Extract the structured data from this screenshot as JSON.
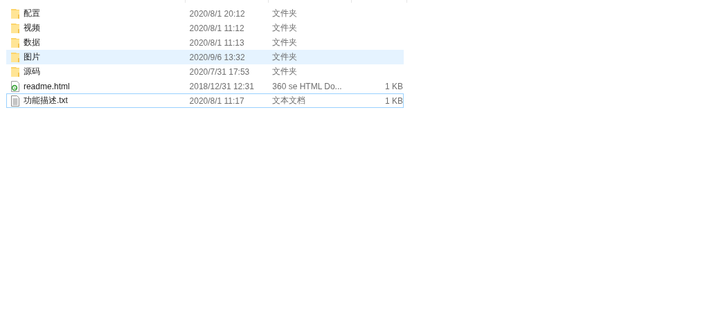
{
  "files": [
    {
      "kind": "folder",
      "name": "配置",
      "modified": "2020/8/1 20:12",
      "type": "文件夹",
      "hovered": false,
      "focused": false
    },
    {
      "kind": "folder",
      "name": "视频",
      "modified": "2020/8/1 11:12",
      "type": "文件夹",
      "hovered": false,
      "focused": false
    },
    {
      "kind": "folder",
      "name": "数据",
      "modified": "2020/8/1 11:13",
      "type": "文件夹",
      "hovered": false,
      "focused": false
    },
    {
      "kind": "folder",
      "name": "图片",
      "modified": "2020/9/6 13:32",
      "type": "文件夹",
      "hovered": true,
      "focused": false
    },
    {
      "kind": "folder",
      "name": "源码",
      "modified": "2020/7/31 17:53",
      "type": "文件夹",
      "hovered": false,
      "focused": false
    },
    {
      "kind": "html",
      "name": "readme.html",
      "modified": "2018/12/31 12:31",
      "type": "360 se HTML Do...",
      "size": "1 KB",
      "hovered": false,
      "focused": false
    },
    {
      "kind": "text",
      "name": "功能描述.txt",
      "modified": "2020/8/1 11:17",
      "type": "文本文档",
      "size": "1 KB",
      "hovered": false,
      "focused": true
    }
  ]
}
